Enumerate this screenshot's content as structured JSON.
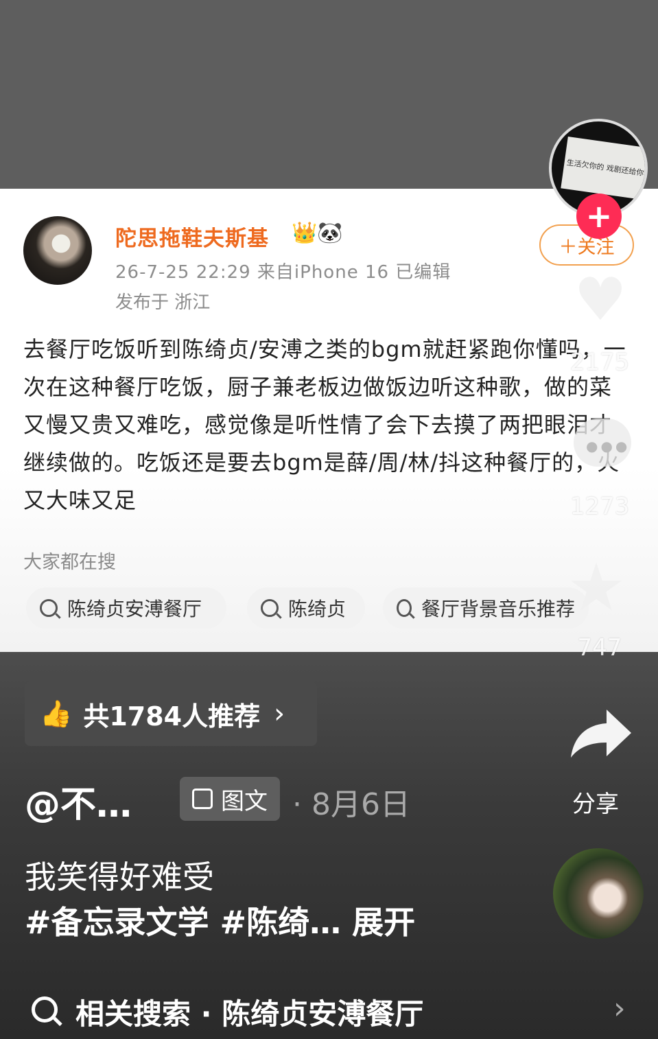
{
  "post": {
    "username": "陀思拖鞋夫斯基",
    "badges": "👑🐼",
    "meta": "26-7-25 22:29  来自iPhone 16  已编辑",
    "location": "发布于 浙江",
    "follow_label": "＋关注",
    "text": "去餐厅吃饭听到陈绮贞/安溥之类的bgm就赶紧跑你懂吗，一次在这种餐厅吃饭，厨子兼老板边做饭边听这种歌，做的菜又慢又贵又难吃，感觉像是听性情了会下去摸了两把眼泪才继续做的。吃饭还是要去bgm是薛/周/林/抖这种餐厅的，火又大味又足",
    "search_title": "大家都在搜",
    "chips": [
      "陈绮贞安溥餐厅",
      "陈绮贞",
      "餐厅背景音乐推荐"
    ]
  },
  "music_disc_text": "生活欠你的 戏剧还给你",
  "actions": {
    "plus": "+",
    "like_count": "2175",
    "comment_count": "1273",
    "favorite_count": "747",
    "share_label": "分享"
  },
  "recommend": {
    "label": "共1784人推荐",
    "chevron": "›"
  },
  "author": "@不…",
  "type_pill": "图文",
  "date": "· 8月6日",
  "caption": "我笑得好难受",
  "hashtags": "#备忘录文学 #陈绮…  展开",
  "related": {
    "text": "相关搜索 · 陈绮贞安溥餐厅",
    "chevron": "›"
  }
}
